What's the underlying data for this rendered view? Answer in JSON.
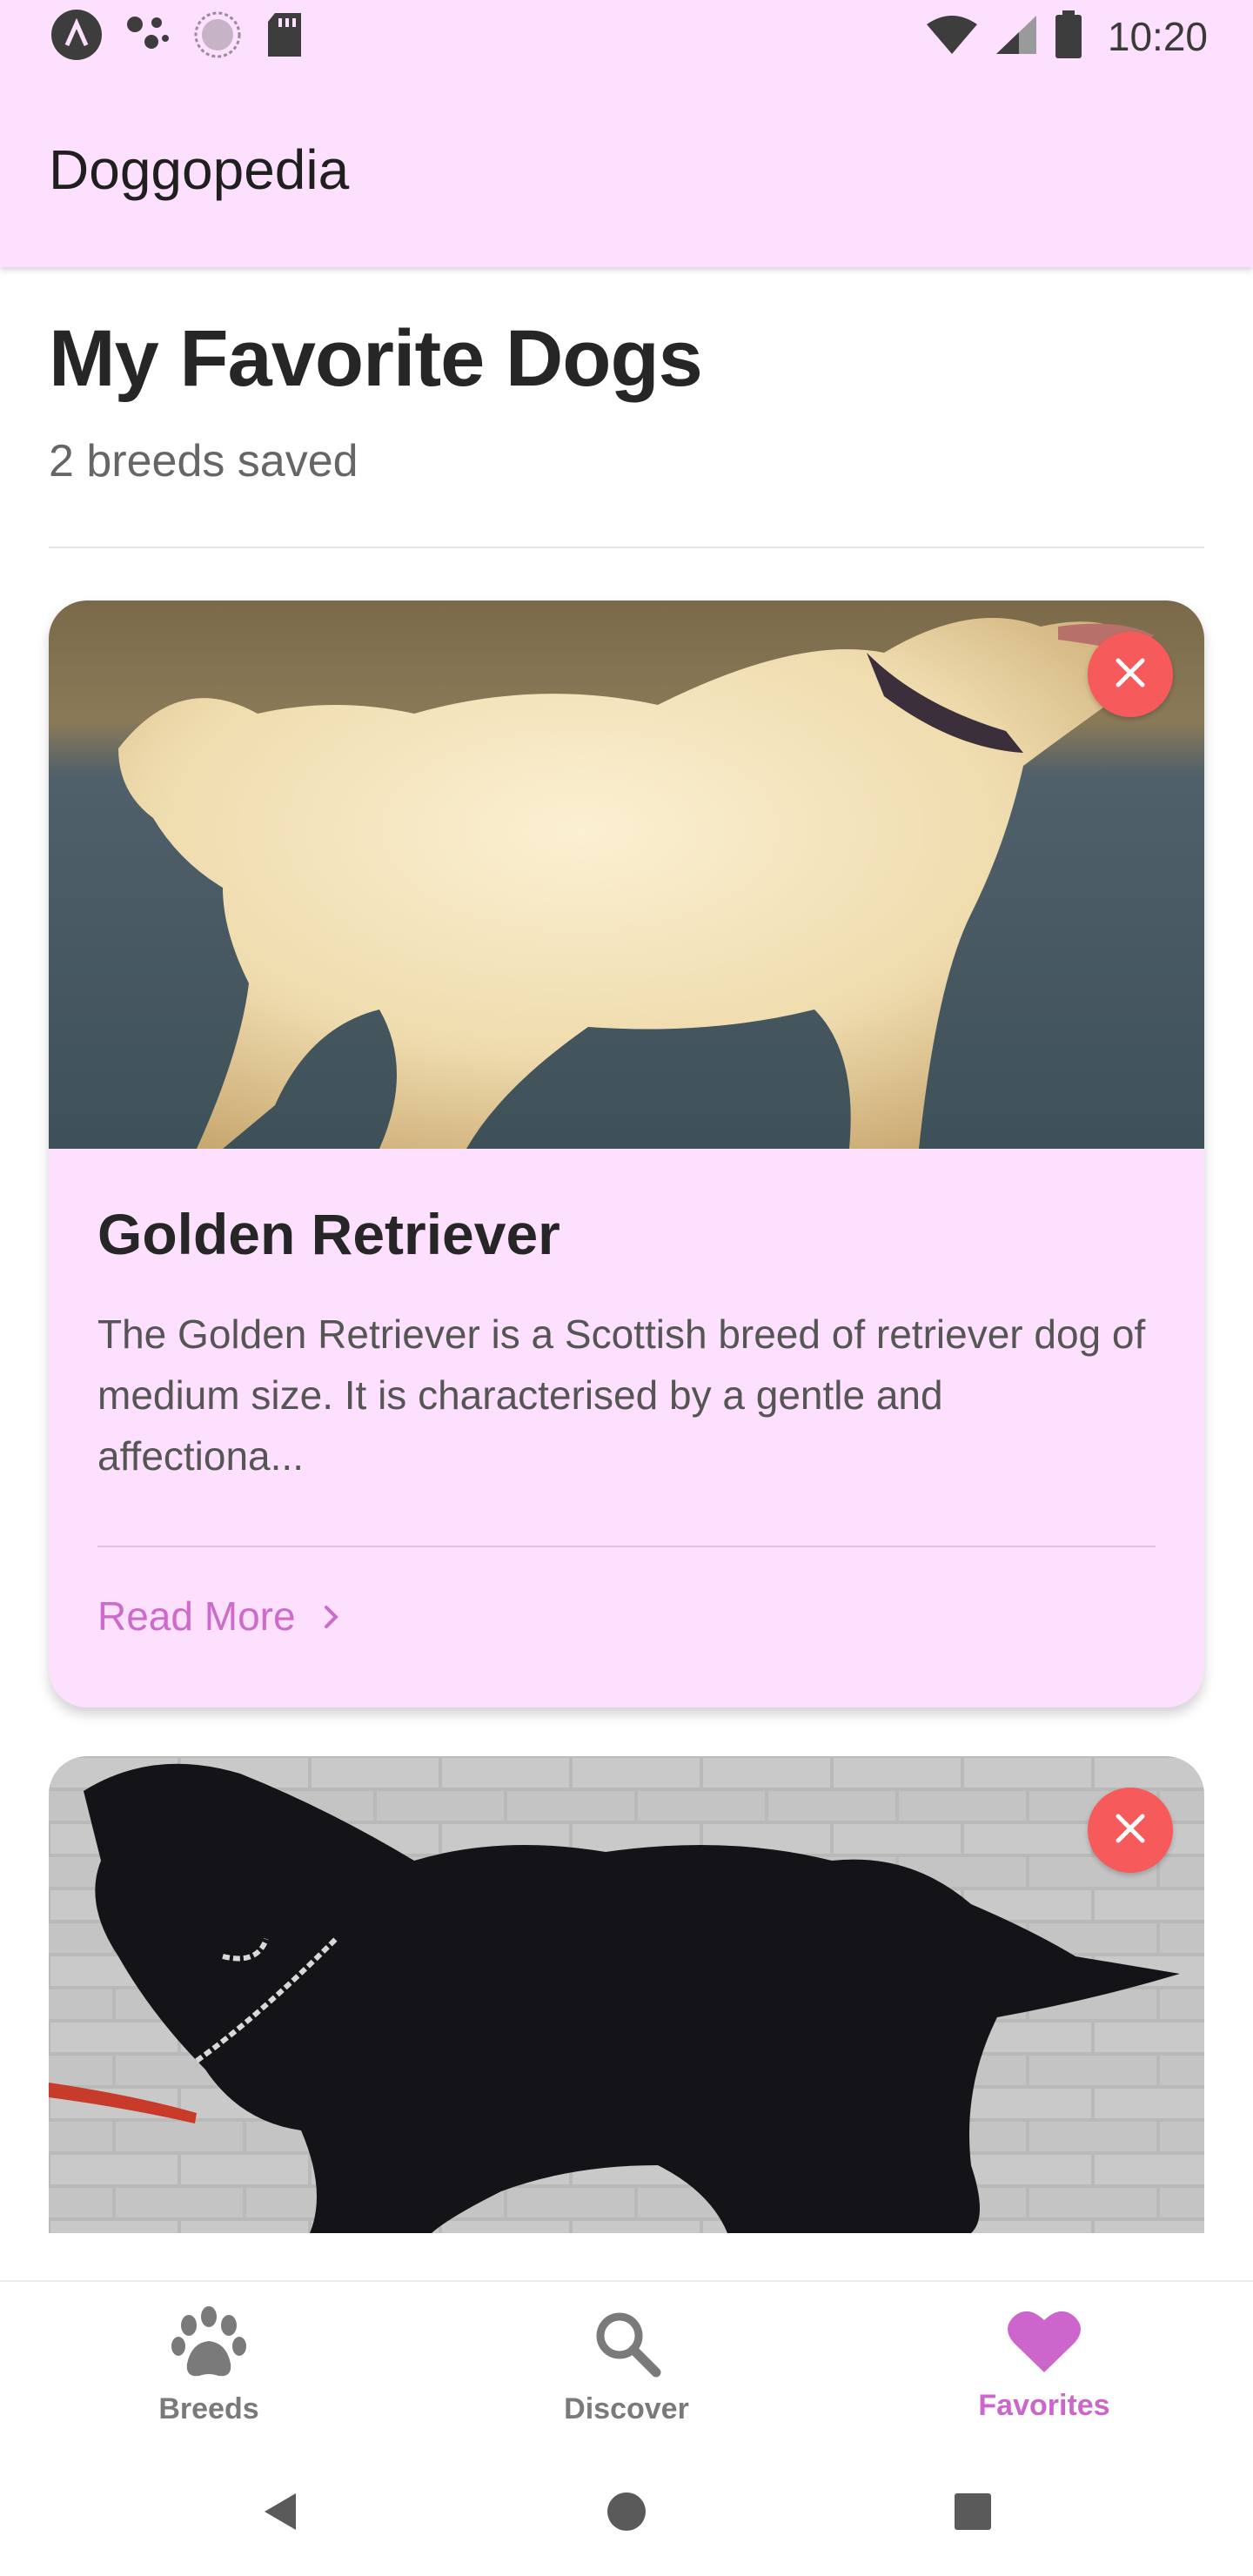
{
  "status_bar": {
    "time": "10:20",
    "left_icons": [
      "app-a-icon",
      "dots-icon",
      "circle-dots-icon",
      "sd-card-icon"
    ],
    "right_icons": [
      "wifi-icon",
      "signal-icon",
      "battery-icon"
    ]
  },
  "app_bar": {
    "title": "Doggopedia"
  },
  "header": {
    "title": "My Favorite Dogs",
    "subtitle": "2 breeds saved"
  },
  "cards": [
    {
      "name": "Golden Retriever",
      "description": "The Golden Retriever is a Scottish breed of retriever dog of medium size. It is characterised by a gentle and affectiona...",
      "read_more": "Read More",
      "photo": "golden-retriever-photo"
    },
    {
      "photo": "black-dog-photo"
    }
  ],
  "bottom_nav": {
    "items": [
      {
        "label": "Breeds",
        "icon": "paw-icon",
        "active": false
      },
      {
        "label": "Discover",
        "icon": "search-icon",
        "active": false
      },
      {
        "label": "Favorites",
        "icon": "heart-icon",
        "active": true
      }
    ]
  },
  "colors": {
    "app_bar_bg": "#fde0fd",
    "card_bg": "#fde0fd",
    "accent": "#cc66cc",
    "remove_button": "#f75a5a"
  }
}
